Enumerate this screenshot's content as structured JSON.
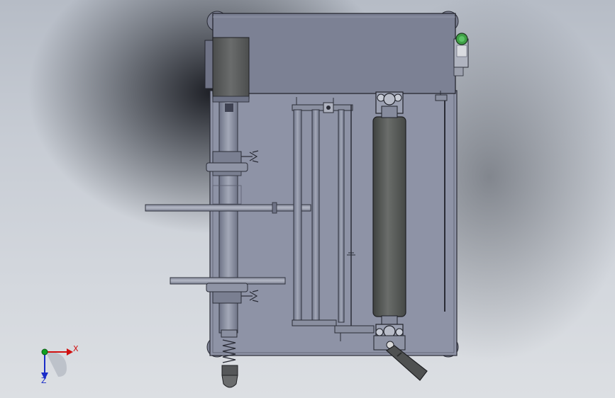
{
  "triad": {
    "x_label": "X",
    "z_label": "Z",
    "colors": {
      "x": "#d01010",
      "y": "#10a020",
      "z": "#1a2cc8"
    }
  },
  "colors": {
    "frame": "#8e93a6",
    "frame_edge": "#2a2c36",
    "top_housing": "#7c8194",
    "motor": "#5a5c5d",
    "roller": "#5b5e5c",
    "shaft": "#8a8fa0",
    "green_button": "#3fa046"
  }
}
